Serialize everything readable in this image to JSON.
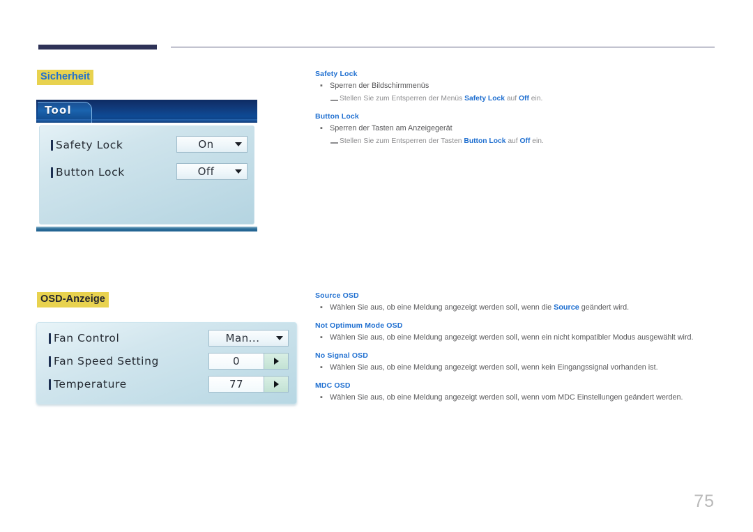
{
  "page": {
    "number": "75"
  },
  "sections": [
    {
      "id": "sicherheit",
      "heading": "Sicherheit"
    },
    {
      "id": "osd_anzeige",
      "heading": "OSD-Anzeige"
    }
  ],
  "panel_tool": {
    "tab_label": "Tool",
    "rows": [
      {
        "label": "Safety Lock",
        "control": "dropdown",
        "value": "On"
      },
      {
        "label": "Button Lock",
        "control": "dropdown",
        "value": "Off"
      }
    ]
  },
  "panel_osd": {
    "rows": [
      {
        "label": "Fan Control",
        "control": "dropdown",
        "value": "Man..."
      },
      {
        "label": "Fan Speed Setting",
        "control": "stepper",
        "value": "0"
      },
      {
        "label": "Temperature",
        "control": "stepper",
        "value": "77"
      }
    ]
  },
  "doc_top": [
    {
      "term": "Safety Lock",
      "bullet": "Sperren der Bildschirmmenüs",
      "note_prefix": "Stellen Sie zum Entsperren der Menüs ",
      "note_bold_1": "Safety Lock",
      "note_mid": " auf ",
      "note_bold_2": "Off",
      "note_suffix": " ein."
    },
    {
      "term": "Button Lock",
      "bullet": "Sperren der Tasten am Anzeigegerät",
      "note_prefix": "Stellen Sie zum Entsperren der Tasten ",
      "note_bold_1": "Button Lock",
      "note_mid": " auf ",
      "note_bold_2": "Off",
      "note_suffix": " ein."
    }
  ],
  "doc_bottom": [
    {
      "term": "Source OSD",
      "bullet_prefix": "Wählen Sie aus, ob eine Meldung angezeigt werden soll, wenn die ",
      "bullet_bold": "Source",
      "bullet_suffix": " geändert wird."
    },
    {
      "term": "Not Optimum Mode OSD",
      "bullet_prefix": "Wählen Sie aus, ob eine Meldung angezeigt werden soll, wenn ein nicht kompatibler Modus ausgewählt wird.",
      "bullet_bold": "",
      "bullet_suffix": ""
    },
    {
      "term": "No Signal OSD",
      "bullet_prefix": "Wählen Sie aus, ob eine Meldung angezeigt werden soll, wenn kein Eingangssignal vorhanden ist.",
      "bullet_bold": "",
      "bullet_suffix": ""
    },
    {
      "term": "MDC OSD",
      "bullet_prefix": "Wählen Sie aus, ob eine Meldung angezeigt werden soll, wenn vom MDC Einstellungen geändert werden.",
      "bullet_bold": "",
      "bullet_suffix": ""
    }
  ],
  "symbols": {
    "bullet": "▪"
  },
  "colors": {
    "accent_blue": "#1f6fd0",
    "highlight_yellow": "#e8d24f",
    "rule_navy": "#2e3257",
    "body_gray": "#58585a"
  }
}
